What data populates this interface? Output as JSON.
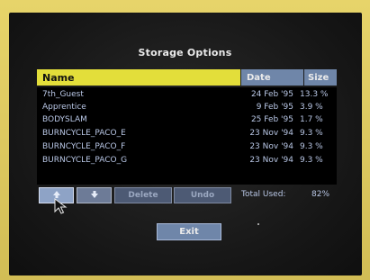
{
  "window": {
    "title": "Storage Options"
  },
  "table": {
    "headers": {
      "name": "Name",
      "date": "Date",
      "size": "Size"
    },
    "rows": [
      {
        "name": "7th_Guest",
        "date": "24 Feb '95",
        "size": "13.3 %"
      },
      {
        "name": "Apprentice",
        "date": "9 Feb '95",
        "size": "3.9 %"
      },
      {
        "name": "BODYSLAM",
        "date": "25 Feb '95",
        "size": "1.7 %"
      },
      {
        "name": "BURNCYCLE_PACO_E",
        "date": "23 Nov '94",
        "size": "9.3 %"
      },
      {
        "name": "BURNCYCLE_PACO_F",
        "date": "23 Nov '94",
        "size": "9.3 %"
      },
      {
        "name": "BURNCYCLE_PACO_G",
        "date": "23 Nov '94",
        "size": "9.3 %"
      }
    ]
  },
  "toolbar": {
    "up_icon": "arrow-up-icon",
    "down_icon": "arrow-down-icon",
    "delete_label": "Delete",
    "undo_label": "Undo"
  },
  "total": {
    "label": "Total Used:",
    "value": "82%"
  },
  "exit_label": "Exit",
  "colors": {
    "bezel": "#d9c45a",
    "header_name": "#e3de3a",
    "header_other": "#6f86a9",
    "text": "#b9c7e6"
  }
}
